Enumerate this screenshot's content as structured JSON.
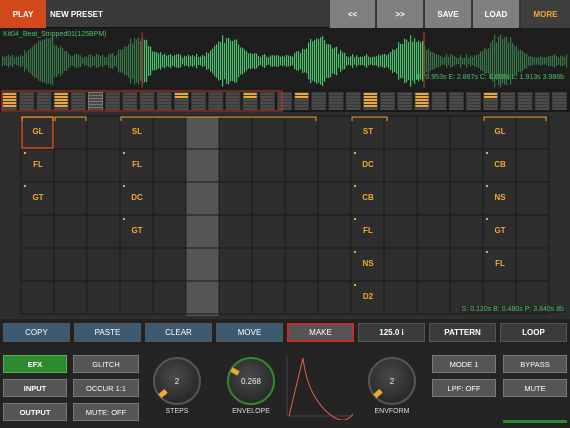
{
  "topbar": {
    "play_label": "PLAY",
    "preset_name": "NEW PRESET",
    "prev_label": "<<",
    "next_label": ">>",
    "save_label": "SAVE",
    "load_label": "LOAD",
    "more_label": "MORE"
  },
  "waveform": {
    "file_name": "Kit04_Beat_Stripped01(125BPM)",
    "stats": "B: 0.953s E: 2.867s C: 0.000s L: 1.913s 3.986b",
    "color": "#4cc06a"
  },
  "grid": {
    "columns": [
      {
        "col": 0,
        "cells": [
          {
            "row": 0,
            "label": "GL"
          },
          {
            "row": 1,
            "label": "FL"
          },
          {
            "row": 2,
            "label": "GT"
          }
        ]
      },
      {
        "col": 3,
        "cells": [
          {
            "row": 0,
            "label": "SL"
          },
          {
            "row": 1,
            "label": "FL"
          },
          {
            "row": 2,
            "label": "DC"
          },
          {
            "row": 3,
            "label": "GT"
          }
        ]
      },
      {
        "col": 10,
        "cells": [
          {
            "row": 0,
            "label": "ST"
          },
          {
            "row": 1,
            "label": "DC"
          },
          {
            "row": 2,
            "label": "CB"
          },
          {
            "row": 3,
            "label": "FL"
          },
          {
            "row": 4,
            "label": "NS"
          },
          {
            "row": 5,
            "label": "D2"
          }
        ]
      },
      {
        "col": 14,
        "cells": [
          {
            "row": 0,
            "label": "GL"
          },
          {
            "row": 1,
            "label": "CB"
          },
          {
            "row": 2,
            "label": "NS"
          },
          {
            "row": 3,
            "label": "GT"
          },
          {
            "row": 4,
            "label": "FL"
          }
        ]
      }
    ],
    "stats": "S: 0.120s B: 0.480s P: 3.840s 8b",
    "accent": "#f0a830"
  },
  "toolbar": {
    "copy_label": "COPY",
    "paste_label": "PASTE",
    "clear_label": "CLEAR",
    "move_label": "MOVE",
    "make_label": "MAKE",
    "tempo_label": "125.0 i",
    "pattern_label": "PATTERN",
    "loop_label": "LOOP"
  },
  "bottom": {
    "efx_label": "EFX",
    "input_label": "INPUT",
    "output_label": "OUTPUT",
    "glitch_label": "GLITCH",
    "occur_label": "OCCUR 1:1",
    "mute_off_label": "MUTE: OFF",
    "steps_value": "2",
    "steps_label": "STEPS",
    "envelope_value": "0.268",
    "envelope_label": "ENVELOPE",
    "envform_value": "2",
    "envform_label": "ENVFORM",
    "mode_label": "MODE 1",
    "lpf_label": "LPF: OFF",
    "bypass_label": "BYPASS",
    "mute_label": "MUTE"
  }
}
